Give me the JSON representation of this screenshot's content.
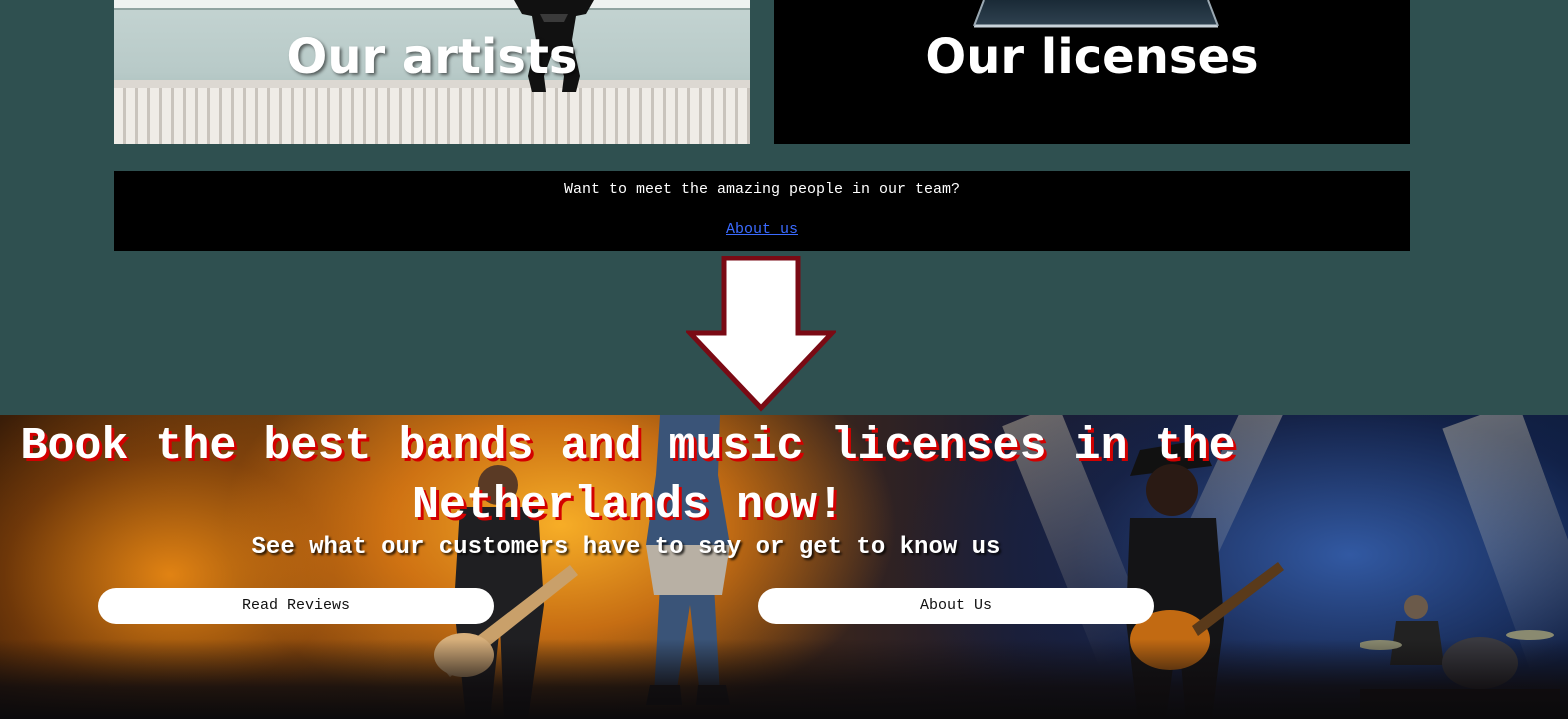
{
  "cards": {
    "artists": {
      "title": "Our artists"
    },
    "licenses": {
      "title": "Our licenses"
    }
  },
  "team": {
    "text": "Want to meet the amazing people in our team?",
    "link_label": "About us"
  },
  "hero": {
    "title": "Book the best bands and music licenses in the Netherlands now!",
    "subtitle": "See what our customers have to say or get to know us",
    "buttons": {
      "reviews_label": "Read Reviews",
      "about_label": "About Us"
    }
  },
  "colors": {
    "page_background": "#2f5050",
    "bar_background": "#000000",
    "link": "#3b6bff",
    "arrow_fill": "#ffffff",
    "arrow_stroke": "#7a0a14",
    "title_shadow": "#d30000"
  },
  "icons": {
    "arrow": "arrow-down-icon"
  }
}
